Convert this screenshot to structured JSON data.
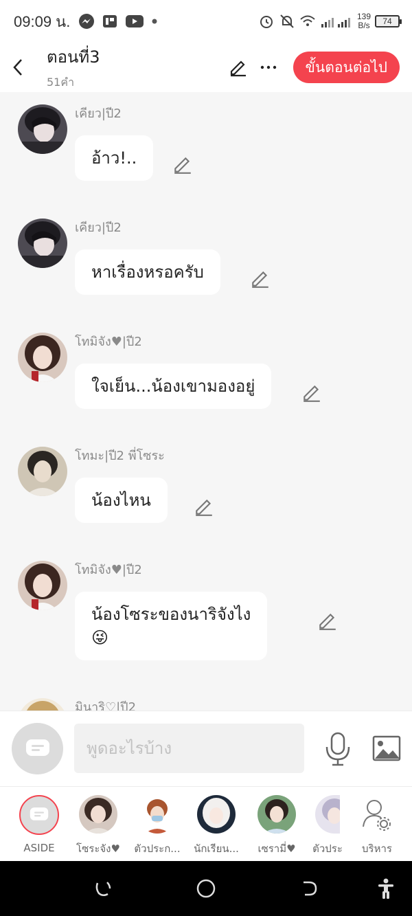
{
  "status": {
    "time": "09:09 น.",
    "net_speed_top": "139",
    "net_speed_bottom": "B/s",
    "battery": "74"
  },
  "header": {
    "title": "ตอนที่3",
    "subtitle": "51คำ",
    "next_label": "ขั้นตอนต่อไป"
  },
  "messages": [
    {
      "sender": "เคียว|ปี2",
      "text": "อ้าว!.."
    },
    {
      "sender": "เคียว|ปี2",
      "text": "หาเรื่องหรอครับ"
    },
    {
      "sender": "โทมิจัง♥|ปี2",
      "text": "ใจเย็น...น้องเขามองอยู่"
    },
    {
      "sender": "โทมะ|ปี2 พี่โซระ",
      "text": "น้องไหน"
    },
    {
      "sender": "โทมิจัง♥|ปี2",
      "text": "น้องโซระของนาริจังไง",
      "emoji": "😜"
    },
    {
      "sender": "มินาริ♡|ปี2"
    }
  ],
  "input": {
    "placeholder": "พูดอะไรบ้าง"
  },
  "characters": [
    {
      "label": "ASIDE"
    },
    {
      "label": "โซระจัง♥"
    },
    {
      "label": "ตัวประก..."
    },
    {
      "label": "นักเรียน..."
    },
    {
      "label": "เซรามี่♥"
    },
    {
      "label": "ตัวประ"
    },
    {
      "label": "บริหาร"
    }
  ],
  "colors": {
    "accent": "#f4434e",
    "background": "#f6f6f6"
  }
}
